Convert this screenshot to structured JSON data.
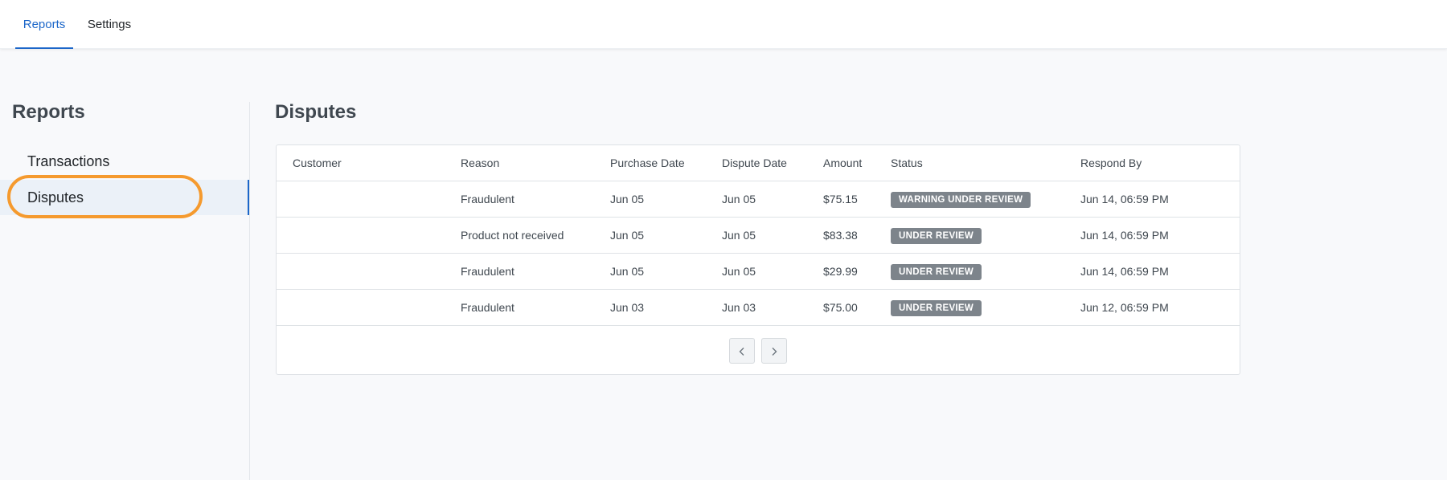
{
  "nav": {
    "tabs": [
      {
        "label": "Reports",
        "active": true
      },
      {
        "label": "Settings",
        "active": false
      }
    ]
  },
  "sidebar": {
    "title": "Reports",
    "items": [
      {
        "label": "Transactions",
        "active": false
      },
      {
        "label": "Disputes",
        "active": true
      }
    ]
  },
  "main": {
    "title": "Disputes",
    "table": {
      "headers": {
        "customer": "Customer",
        "reason": "Reason",
        "purchase_date": "Purchase Date",
        "dispute_date": "Dispute Date",
        "amount": "Amount",
        "status": "Status",
        "respond_by": "Respond By"
      },
      "rows": [
        {
          "customer": "",
          "reason": "Fraudulent",
          "purchase_date": "Jun 05",
          "dispute_date": "Jun 05",
          "amount": "$75.15",
          "status": "WARNING UNDER REVIEW",
          "respond_by": "Jun 14, 06:59 PM"
        },
        {
          "customer": "",
          "reason": "Product not received",
          "purchase_date": "Jun 05",
          "dispute_date": "Jun 05",
          "amount": "$83.38",
          "status": "UNDER REVIEW",
          "respond_by": "Jun 14, 06:59 PM"
        },
        {
          "customer": "",
          "reason": "Fraudulent",
          "purchase_date": "Jun 05",
          "dispute_date": "Jun 05",
          "amount": "$29.99",
          "status": "UNDER REVIEW",
          "respond_by": "Jun 14, 06:59 PM"
        },
        {
          "customer": "",
          "reason": "Fraudulent",
          "purchase_date": "Jun 03",
          "dispute_date": "Jun 03",
          "amount": "$75.00",
          "status": "UNDER REVIEW",
          "respond_by": "Jun 12, 06:59 PM"
        }
      ]
    },
    "pagination": {
      "prev_icon": "chevron-left-icon",
      "next_icon": "chevron-right-icon"
    }
  },
  "colors": {
    "accent": "#1b66c9",
    "highlight_ring": "#f59a2e",
    "badge_bg": "#7d848b",
    "page_bg": "#f8f9fb"
  }
}
